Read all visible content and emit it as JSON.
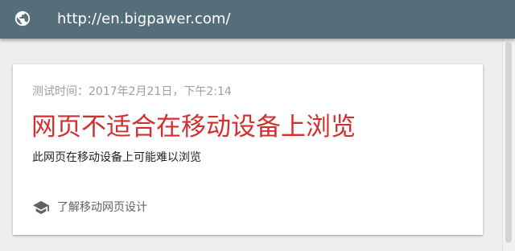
{
  "address_bar": {
    "url": "http://en.bigpawer.com/",
    "icon": "globe-icon"
  },
  "result_card": {
    "test_time": "测试时间：2017年2月21日，下午2:14",
    "title": "网页不适合在移动设备上浏览",
    "detail": "此网页在移动设备上可能难以浏览",
    "learn_link": {
      "label": "了解移动网页设计",
      "icon": "graduation-cap-icon"
    }
  },
  "colors": {
    "header_background": "#546e7a",
    "page_background": "#eeeeee",
    "card_background": "#ffffff",
    "title_red": "#d32f2f",
    "muted_text": "#9e9e9e"
  }
}
